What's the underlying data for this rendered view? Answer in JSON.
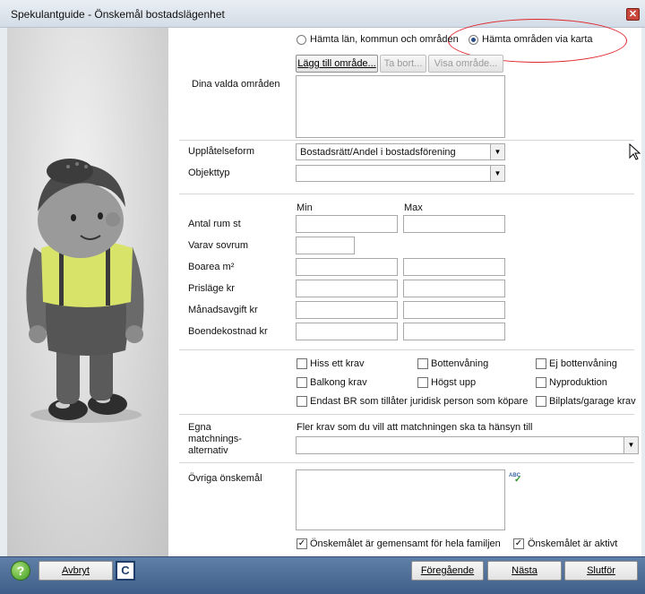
{
  "window": {
    "title": "Spekulantguide - Önskemål bostadslägenhet",
    "close": "✕"
  },
  "areas": {
    "radio_lan": "Hämta län, kommun och områden",
    "radio_karta": "Hämta områden via karta",
    "add_button": "Lägg till område...",
    "remove_button": "Ta bort...",
    "show_button": "Visa område...",
    "selected_label": "Dina valda områden"
  },
  "form": {
    "upplatelseform_label": "Upplåtelseform",
    "upplatelseform_value": "Bostadsrätt/Andel i bostadsförening",
    "objekttyp_label": "Objekttyp",
    "objekttyp_value": "",
    "min_label": "Min",
    "max_label": "Max",
    "rows": [
      {
        "label": "Antal rum st"
      },
      {
        "label": "Varav sovrum"
      },
      {
        "label": "Boarea m²"
      },
      {
        "label": "Prisläge kr"
      },
      {
        "label": "Månadsavgift kr"
      },
      {
        "label": "Boendekostnad kr"
      }
    ]
  },
  "checkboxes": [
    {
      "label": "Hiss ett krav",
      "checked": false
    },
    {
      "label": "Bottenvåning",
      "checked": false
    },
    {
      "label": "Ej bottenvåning",
      "checked": false
    },
    {
      "label": "Balkong krav",
      "checked": false
    },
    {
      "label": "Högst upp",
      "checked": false
    },
    {
      "label": "Nyproduktion",
      "checked": false
    },
    {
      "label": "Endast BR som tillåter juridisk person som köpare",
      "checked": false
    },
    {
      "label": "Bilplats/garage krav",
      "checked": false
    }
  ],
  "matching": {
    "label": "Egna matchnings- alternativ",
    "label_lines": [
      "Egna",
      "matchnings-",
      "alternativ"
    ],
    "hint": "Fler krav som du vill att matchningen ska ta hänsyn till",
    "value": ""
  },
  "other": {
    "label": "Övriga önskemål",
    "spell_icon_text": "ABC",
    "value": "",
    "family_checkbox": "Önskemålet är gemensamt för hela familjen",
    "family_checked": true,
    "active_checkbox": "Önskemålet är aktivt",
    "active_checked": true
  },
  "footer": {
    "help": "?",
    "cancel": "Avbryt",
    "c_icon": "C",
    "previous": "Föregående",
    "next": "Nästa",
    "finish": "Slutför"
  },
  "colors": {
    "accent_ellipse": "#e0262b",
    "footer_bar": "#4d6d98"
  }
}
